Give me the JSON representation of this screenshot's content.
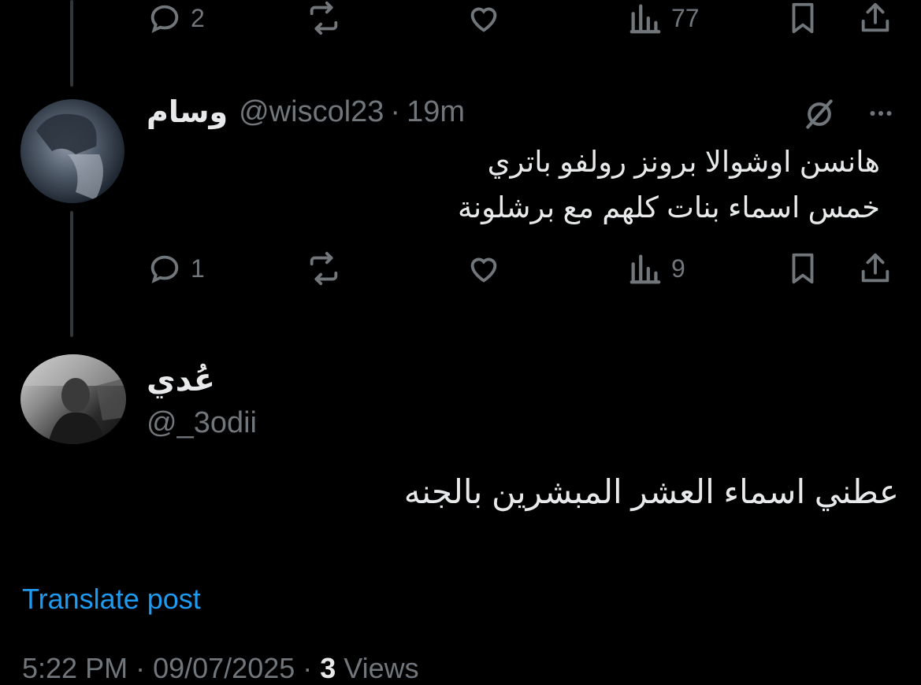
{
  "top_actions": {
    "reply_count": "2",
    "views_count": "77"
  },
  "reply1": {
    "name": "وسام",
    "handle": "@wiscol23",
    "separator": "·",
    "time": "19m",
    "text_line1": "هانسن اوشوالا برونز رولفو باتري",
    "text_line2": "خمس اسماء بنات كلهم مع برشلونة",
    "reply_count": "1",
    "views_count": "9"
  },
  "main": {
    "name": "عُدي",
    "handle": "@_3odii",
    "text": "عطني اسماء العشر المبشرين بالجنه",
    "translate": "Translate post",
    "time": "5:22 PM",
    "date": "09/07/2025",
    "separator": "·",
    "views_count": "3",
    "views_label": "Views"
  },
  "colors": {
    "background": "#000000",
    "text": "#e7e9ea",
    "muted": "#71767b",
    "link": "#1d9bf0",
    "line": "#333639"
  },
  "icons": [
    "reply-icon",
    "repost-icon",
    "like-icon",
    "views-icon",
    "bookmark-icon",
    "share-icon",
    "grok-icon",
    "more-icon"
  ]
}
